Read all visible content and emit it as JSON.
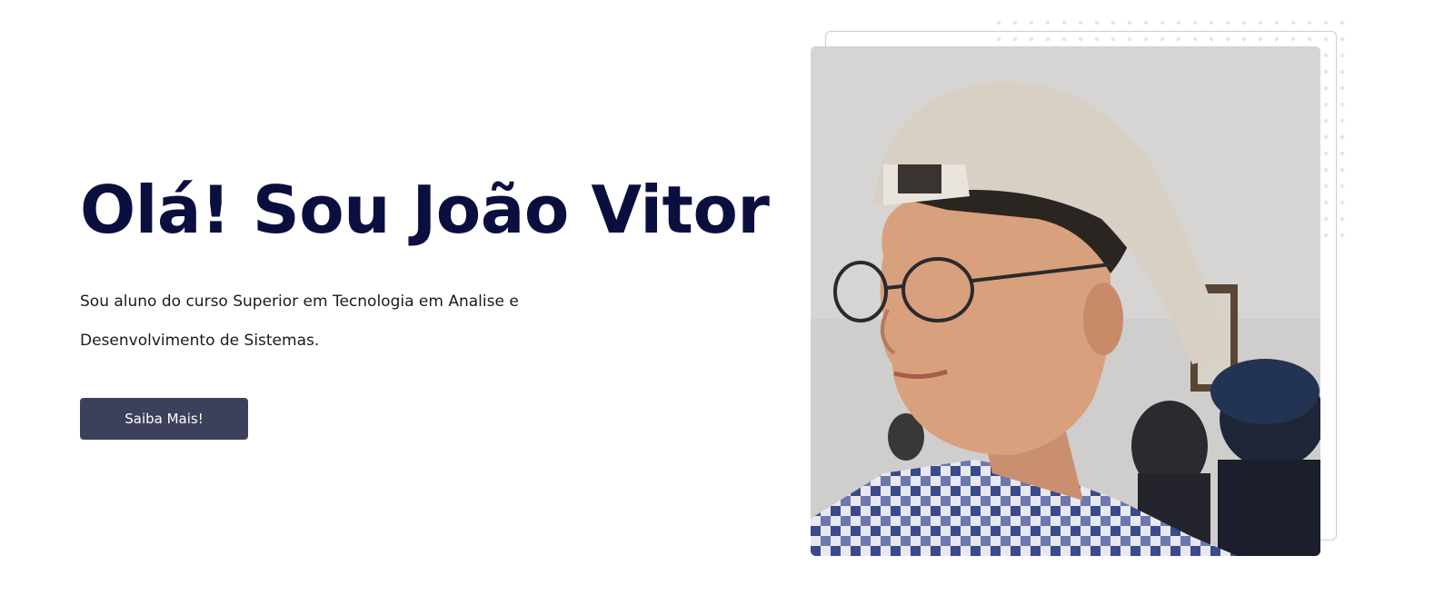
{
  "hero": {
    "title": "Olá! Sou João Vitor",
    "description_line1": "Sou aluno do curso Superior em Tecnologia em Analise e",
    "description_line2": "Desenvolvimento de Sistemas.",
    "cta_label": "Saiba Mais!"
  },
  "colors": {
    "title": "#0b0f3f",
    "button_bg": "#3d405b",
    "button_text": "#ffffff",
    "frame_outline": "#c9c9e6"
  },
  "photo": {
    "icon": "profile-photo"
  }
}
